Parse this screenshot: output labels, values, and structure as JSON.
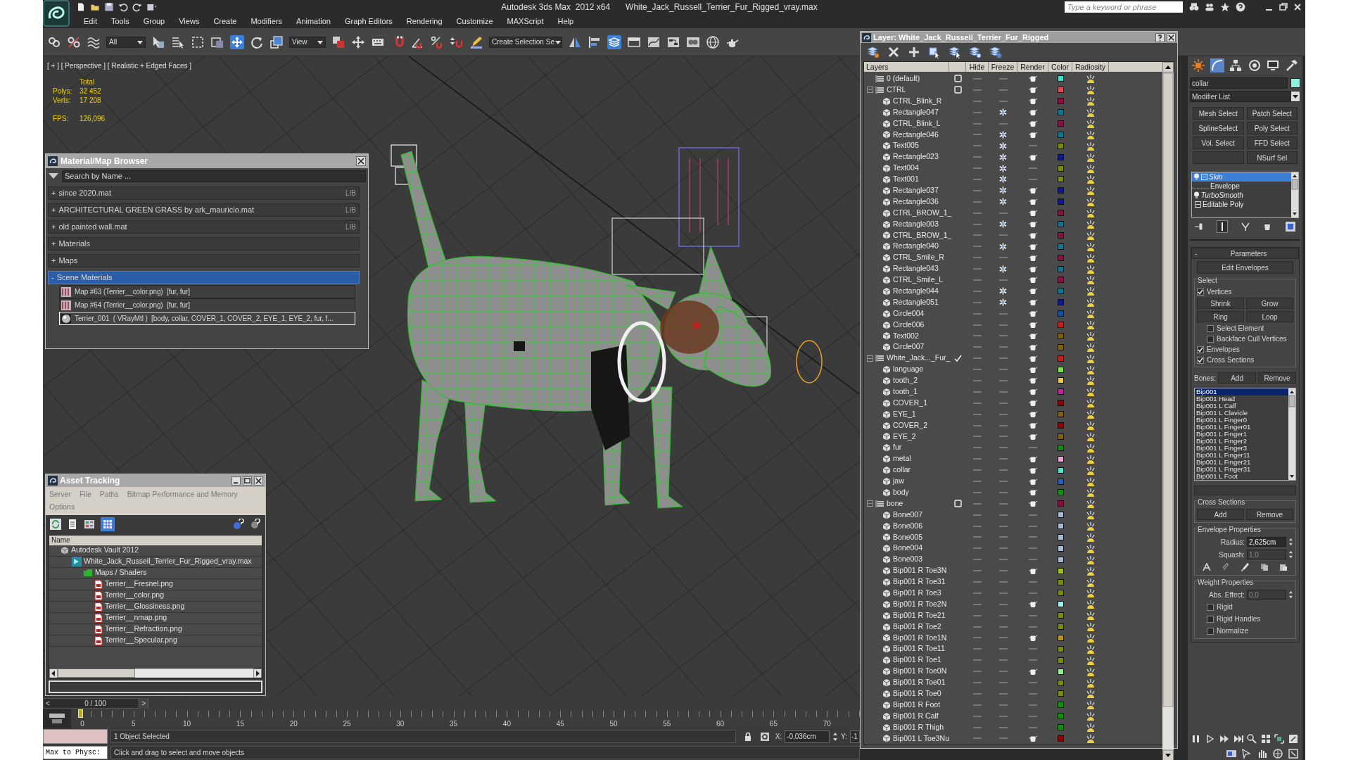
{
  "window": {
    "title": "Autodesk 3ds Max  2012 x64",
    "file": "White_Jack_Russell_Terrier_Fur_Rigged_vray.max",
    "search_placeholder": "Type a keyword or phrase"
  },
  "menu": [
    "Edit",
    "Tools",
    "Group",
    "Views",
    "Create",
    "Modifiers",
    "Animation",
    "Graph Editors",
    "Rendering",
    "Customize",
    "MAXScript",
    "Help"
  ],
  "toolbar": {
    "selection_filter": "All",
    "reference_coordinates": "View",
    "named_selection": "Create Selection Se"
  },
  "viewport": {
    "label": "[ + ] [ Perspective ] [ Realistic + Edged Faces ]",
    "stats": {
      "header": "Total",
      "rows": [
        {
          "label": "Polys:",
          "value": "32 452"
        },
        {
          "label": "Verts:",
          "value": "17 208"
        }
      ],
      "fps": {
        "label": "FPS:",
        "value": "126,096"
      }
    }
  },
  "material_browser": {
    "title": "Material/Map Browser",
    "search_placeholder": "Search by Name ...",
    "groups": [
      {
        "sign": "+",
        "label": "since 2020.mat",
        "tag": "LIB",
        "selected": false
      },
      {
        "sign": "+",
        "label": "ARCHITECTURAL GREEN GRASS by ark_mauricio.mat",
        "tag": "LIB",
        "selected": false
      },
      {
        "sign": "+",
        "label": "old painted wall.mat",
        "tag": "LIB",
        "selected": false
      },
      {
        "sign": "+",
        "label": "Materials",
        "selected": false
      },
      {
        "sign": "+",
        "label": "Maps",
        "selected": false
      },
      {
        "sign": "-",
        "label": "Scene Materials",
        "selected": true
      }
    ],
    "items": [
      {
        "kind": "map",
        "label": "Map #63 (Terrier__color.png)  [fur, fur]",
        "selected": false
      },
      {
        "kind": "map",
        "label": "Map #64 (Terrier__color.png)  [fur, fur]",
        "selected": false
      },
      {
        "kind": "material",
        "label": "Terrier_001  ( VRayMtl )  [body, collar, COVER_1, COVER_2, EYE_1, EYE_2, fur, f...",
        "selected": true
      }
    ]
  },
  "asset_tracking": {
    "title": "Asset Tracking",
    "menu": [
      "Server",
      "File",
      "Paths",
      "Bitmap Performance and Memory",
      "Options"
    ],
    "column": "Name",
    "tree": [
      {
        "kind": "vault",
        "label": "Autodesk Vault 2012",
        "children": [
          {
            "kind": "scene",
            "label": "White_Jack_Russell_Terrier_Fur_Rigged_vray.max",
            "children": [
              {
                "kind": "folder",
                "label": "Maps / Shaders",
                "children": [
                  {
                    "kind": "image",
                    "label": "Terrier__Fresnel.png"
                  },
                  {
                    "kind": "image",
                    "label": "Terrier__color.png"
                  },
                  {
                    "kind": "image",
                    "label": "Terrier__Glossiness.png"
                  },
                  {
                    "kind": "image",
                    "label": "Terrier__nmap.png"
                  },
                  {
                    "kind": "image",
                    "label": "Terrier__Refraction.png"
                  },
                  {
                    "kind": "image",
                    "label": "Terrier__Specular.png"
                  }
                ]
              }
            ]
          }
        ]
      }
    ]
  },
  "layer_manager": {
    "title": "Layer: White_Jack_Russell_Terrier_Fur_Rigged",
    "columns": [
      "Layers",
      "Hide",
      "Freeze",
      "Render",
      "Color",
      "Radiosity"
    ],
    "layers": [
      {
        "name": "0 (default)",
        "current": false,
        "renderable": true,
        "color": "#44dcc4"
      },
      {
        "name": "CTRL",
        "expanded": true,
        "current": false,
        "renderable": true,
        "color": "#e05050",
        "children": [
          {
            "name": "CTRL_Blink_R",
            "frozen": false,
            "renderable": true,
            "color": "#8c1040"
          },
          {
            "name": "Rectangle047",
            "frozen": true,
            "renderable": true,
            "color": "#107890"
          },
          {
            "name": "CTRL_Blink_L",
            "frozen": false,
            "renderable": true,
            "color": "#8c1040"
          },
          {
            "name": "Rectangle046",
            "frozen": true,
            "renderable": true,
            "color": "#107890"
          },
          {
            "name": "Text005",
            "frozen": true,
            "renderable": false,
            "color": "#7a8a10"
          },
          {
            "name": "Rectangle023",
            "frozen": true,
            "renderable": true,
            "color": "#101890"
          },
          {
            "name": "Text004",
            "frozen": true,
            "renderable": false,
            "color": "#7a8a10"
          },
          {
            "name": "Text001",
            "frozen": true,
            "renderable": false,
            "color": "#7a8a10"
          },
          {
            "name": "Rectangle037",
            "frozen": true,
            "renderable": true,
            "color": "#101890"
          },
          {
            "name": "Rectangle036",
            "frozen": true,
            "renderable": true,
            "color": "#101890"
          },
          {
            "name": "CTRL_BROW_1_",
            "frozen": false,
            "renderable": true,
            "color": "#8c1040"
          },
          {
            "name": "Rectangle003",
            "frozen": true,
            "renderable": true,
            "color": "#107890"
          },
          {
            "name": "CTRL_BROW_1_",
            "frozen": false,
            "renderable": true,
            "color": "#8c1040"
          },
          {
            "name": "Rectangle040",
            "frozen": true,
            "renderable": true,
            "color": "#107890"
          },
          {
            "name": "CTRL_Smile_R",
            "frozen": false,
            "renderable": true,
            "color": "#8c1040"
          },
          {
            "name": "Rectangle043",
            "frozen": true,
            "renderable": true,
            "color": "#107890"
          },
          {
            "name": "CTRL_Smile_L",
            "frozen": false,
            "renderable": true,
            "color": "#8c1040"
          },
          {
            "name": "Rectangle044",
            "frozen": true,
            "renderable": true,
            "color": "#107890"
          },
          {
            "name": "Rectangle051",
            "frozen": true,
            "renderable": true,
            "color": "#101890"
          },
          {
            "name": "Circle004",
            "frozen": false,
            "renderable": true,
            "color": "#1050a0"
          },
          {
            "name": "Circle006",
            "frozen": false,
            "renderable": true,
            "color": "#c02020"
          },
          {
            "name": "Text002",
            "frozen": false,
            "renderable": true,
            "color": "#806010"
          },
          {
            "name": "Circle007",
            "frozen": false,
            "renderable": true,
            "color": "#806010"
          }
        ]
      },
      {
        "name": "White_Jack..._Fur_",
        "expanded": true,
        "current": true,
        "renderable": true,
        "color": "#c02020",
        "children": [
          {
            "name": "language",
            "frozen": false,
            "renderable": true,
            "color": "#80e050"
          },
          {
            "name": "tooth_2",
            "frozen": false,
            "renderable": true,
            "color": "#e8c850"
          },
          {
            "name": "tooth_1",
            "frozen": false,
            "renderable": true,
            "color": "#c020a0"
          },
          {
            "name": "COVER_1",
            "frozen": false,
            "renderable": true,
            "color": "#900000"
          },
          {
            "name": "EYE_1",
            "frozen": false,
            "renderable": true,
            "color": "#806010"
          },
          {
            "name": "COVER_2",
            "frozen": false,
            "renderable": true,
            "color": "#900000"
          },
          {
            "name": "EYE_2",
            "frozen": false,
            "renderable": true,
            "color": "#806010"
          },
          {
            "name": "fur",
            "frozen": false,
            "renderable": false,
            "color": "#109010"
          },
          {
            "name": "metal",
            "frozen": false,
            "renderable": true,
            "color": "#f0a0d8"
          },
          {
            "name": "collar",
            "frozen": false,
            "renderable": true,
            "color": "#50e0d0"
          },
          {
            "name": "jaw",
            "frozen": false,
            "renderable": true,
            "color": "#2060c0"
          },
          {
            "name": "body",
            "frozen": false,
            "renderable": true,
            "color": "#109010"
          }
        ]
      },
      {
        "name": "bone",
        "expanded": true,
        "current": false,
        "renderable": true,
        "color": "#900840",
        "children": [
          {
            "name": "Bone007",
            "frozen": false,
            "renderable": false,
            "color": "#a8b8d0"
          },
          {
            "name": "Bone006",
            "frozen": false,
            "renderable": false,
            "color": "#a8b8d0"
          },
          {
            "name": "Bone005",
            "frozen": false,
            "renderable": false,
            "color": "#a8b8d0"
          },
          {
            "name": "Bone004",
            "frozen": false,
            "renderable": false,
            "color": "#a8b8d0"
          },
          {
            "name": "Bone003",
            "frozen": false,
            "renderable": false,
            "color": "#a8b8d0"
          },
          {
            "name": "Bip001 R Toe3N",
            "frozen": false,
            "renderable": true,
            "color": "#a0c020"
          },
          {
            "name": "Bip001 R Toe31",
            "frozen": false,
            "renderable": false,
            "color": "#7a8a10"
          },
          {
            "name": "Bip001 R Toe3",
            "frozen": false,
            "renderable": false,
            "color": "#7a8a10"
          },
          {
            "name": "Bip001 R Toe2N",
            "frozen": false,
            "renderable": true,
            "color": "#a0f0f0"
          },
          {
            "name": "Bip001 R Toe21",
            "frozen": false,
            "renderable": false,
            "color": "#7a8a10"
          },
          {
            "name": "Bip001 R Toe2",
            "frozen": false,
            "renderable": false,
            "color": "#7a8a10"
          },
          {
            "name": "Bip001 R Toe1N",
            "frozen": false,
            "renderable": true,
            "color": "#c09020"
          },
          {
            "name": "Bip001 R Toe11",
            "frozen": false,
            "renderable": false,
            "color": "#7a8a10"
          },
          {
            "name": "Bip001 R Toe1",
            "frozen": false,
            "renderable": false,
            "color": "#7a8a10"
          },
          {
            "name": "Bip001 R Toe0N",
            "frozen": false,
            "renderable": true,
            "color": "#90f090"
          },
          {
            "name": "Bip001 R Toe01",
            "frozen": false,
            "renderable": false,
            "color": "#7a8a10"
          },
          {
            "name": "Bip001 R Toe0",
            "frozen": false,
            "renderable": false,
            "color": "#7a8a10"
          },
          {
            "name": "Bip001 R Foot",
            "frozen": false,
            "renderable": false,
            "color": "#109010"
          },
          {
            "name": "Bip001 R Calf",
            "frozen": false,
            "renderable": false,
            "color": "#109010"
          },
          {
            "name": "Bip001 R Thigh",
            "frozen": false,
            "renderable": false,
            "color": "#109010"
          },
          {
            "name": "Bip001 L Toe3Nu",
            "frozen": false,
            "renderable": true,
            "color": "#900000"
          }
        ]
      }
    ]
  },
  "command_panel": {
    "object_name": "collar",
    "modifier_list": "Modifier List",
    "buttons": [
      {
        "kind": "button",
        "label": "Mesh Select"
      },
      {
        "kind": "button",
        "label": "Patch Select"
      },
      {
        "kind": "button",
        "label": "SplineSelect"
      },
      {
        "kind": "button",
        "label": "Poly Select"
      },
      {
        "kind": "button",
        "label": "Vol. Select"
      },
      {
        "kind": "button",
        "label": "FFD Select"
      },
      {
        "kind": "blank"
      },
      {
        "kind": "button",
        "label": "NSurf Sel"
      }
    ],
    "stack": [
      {
        "kind": "modifier",
        "label": "Skin",
        "expanded": true,
        "selected": true
      },
      {
        "kind": "sub",
        "label": "Envelope",
        "selected": false
      },
      {
        "kind": "modifier",
        "label": "TurboSmooth",
        "selected": false
      },
      {
        "kind": "base",
        "label": "Editable Poly",
        "expanded": true,
        "selected": false
      }
    ],
    "parameters": {
      "sign": "-",
      "title": "Parameters",
      "edit_button": "Edit Envelopes",
      "select": {
        "title": "Select",
        "vertices": {
          "label": "Vertices",
          "checked": true
        },
        "buttons": [
          "Shrink",
          "Grow",
          "Ring",
          "Loop"
        ],
        "options": [
          {
            "label": "Select Element",
            "checked": false
          },
          {
            "label": "Backface Cull Vertices",
            "checked": false
          }
        ],
        "display": [
          {
            "label": "Envelopes",
            "checked": true
          },
          {
            "label": "Cross Sections",
            "checked": true
          }
        ]
      },
      "bones": {
        "label": "Bones:",
        "add": "Add",
        "remove": "Remove",
        "items": [
          {
            "label": "Bip001",
            "selected": true
          },
          {
            "label": "Bip001 Head",
            "selected": false
          },
          {
            "label": "Bip001 L Calf",
            "selected": false
          },
          {
            "label": "Bip001 L Clavicle",
            "selected": false
          },
          {
            "label": "Bip001 L Finger0",
            "selected": false
          },
          {
            "label": "Bip001 L Finger01",
            "selected": false
          },
          {
            "label": "Bip001 L Finger1",
            "selected": false
          },
          {
            "label": "Bip001 L Finger2",
            "selected": false
          },
          {
            "label": "Bip001 L Finger3",
            "selected": false
          },
          {
            "label": "Bip001 L Finger11",
            "selected": false
          },
          {
            "label": "Bip001 L Finger21",
            "selected": false
          },
          {
            "label": "Bip001 L Finger31",
            "selected": false
          },
          {
            "label": "Bip001 L Foot",
            "selected": false
          }
        ]
      },
      "cross_sections": {
        "title": "Cross Sections",
        "add": "Add",
        "remove": "Remove"
      },
      "envelope_properties": {
        "title": "Envelope Properties",
        "fields": [
          {
            "label": "Radius:",
            "value": "2,625cm",
            "disabled": false
          },
          {
            "label": "Squash:",
            "value": "1,0",
            "disabled": true
          }
        ]
      },
      "weight_properties": {
        "title": "Weight Properties",
        "fields": [
          {
            "label": "Abs. Effect:",
            "value": "0,0",
            "disabled": true
          }
        ],
        "options": [
          {
            "label": "Rigid",
            "checked": false
          },
          {
            "label": "Rigid Handles",
            "checked": false
          },
          {
            "label": "Normalize",
            "checked": false
          }
        ]
      }
    }
  },
  "timeline": {
    "prev": "<",
    "label": "0 / 100",
    "next": ">",
    "level": 0,
    "ticks": [
      "0",
      "5",
      "10",
      "15",
      "20",
      "25",
      "30",
      "35",
      "40",
      "45",
      "50",
      "55",
      "60",
      "65",
      "70"
    ]
  },
  "status": {
    "listener": "Max to Physc:",
    "selection": "1 Object Selected",
    "prompt": "Click and drag to select and move objects",
    "x_label": "X:",
    "x_value": "-0,036cm",
    "y_label": "Y:",
    "y_value": "-1"
  }
}
